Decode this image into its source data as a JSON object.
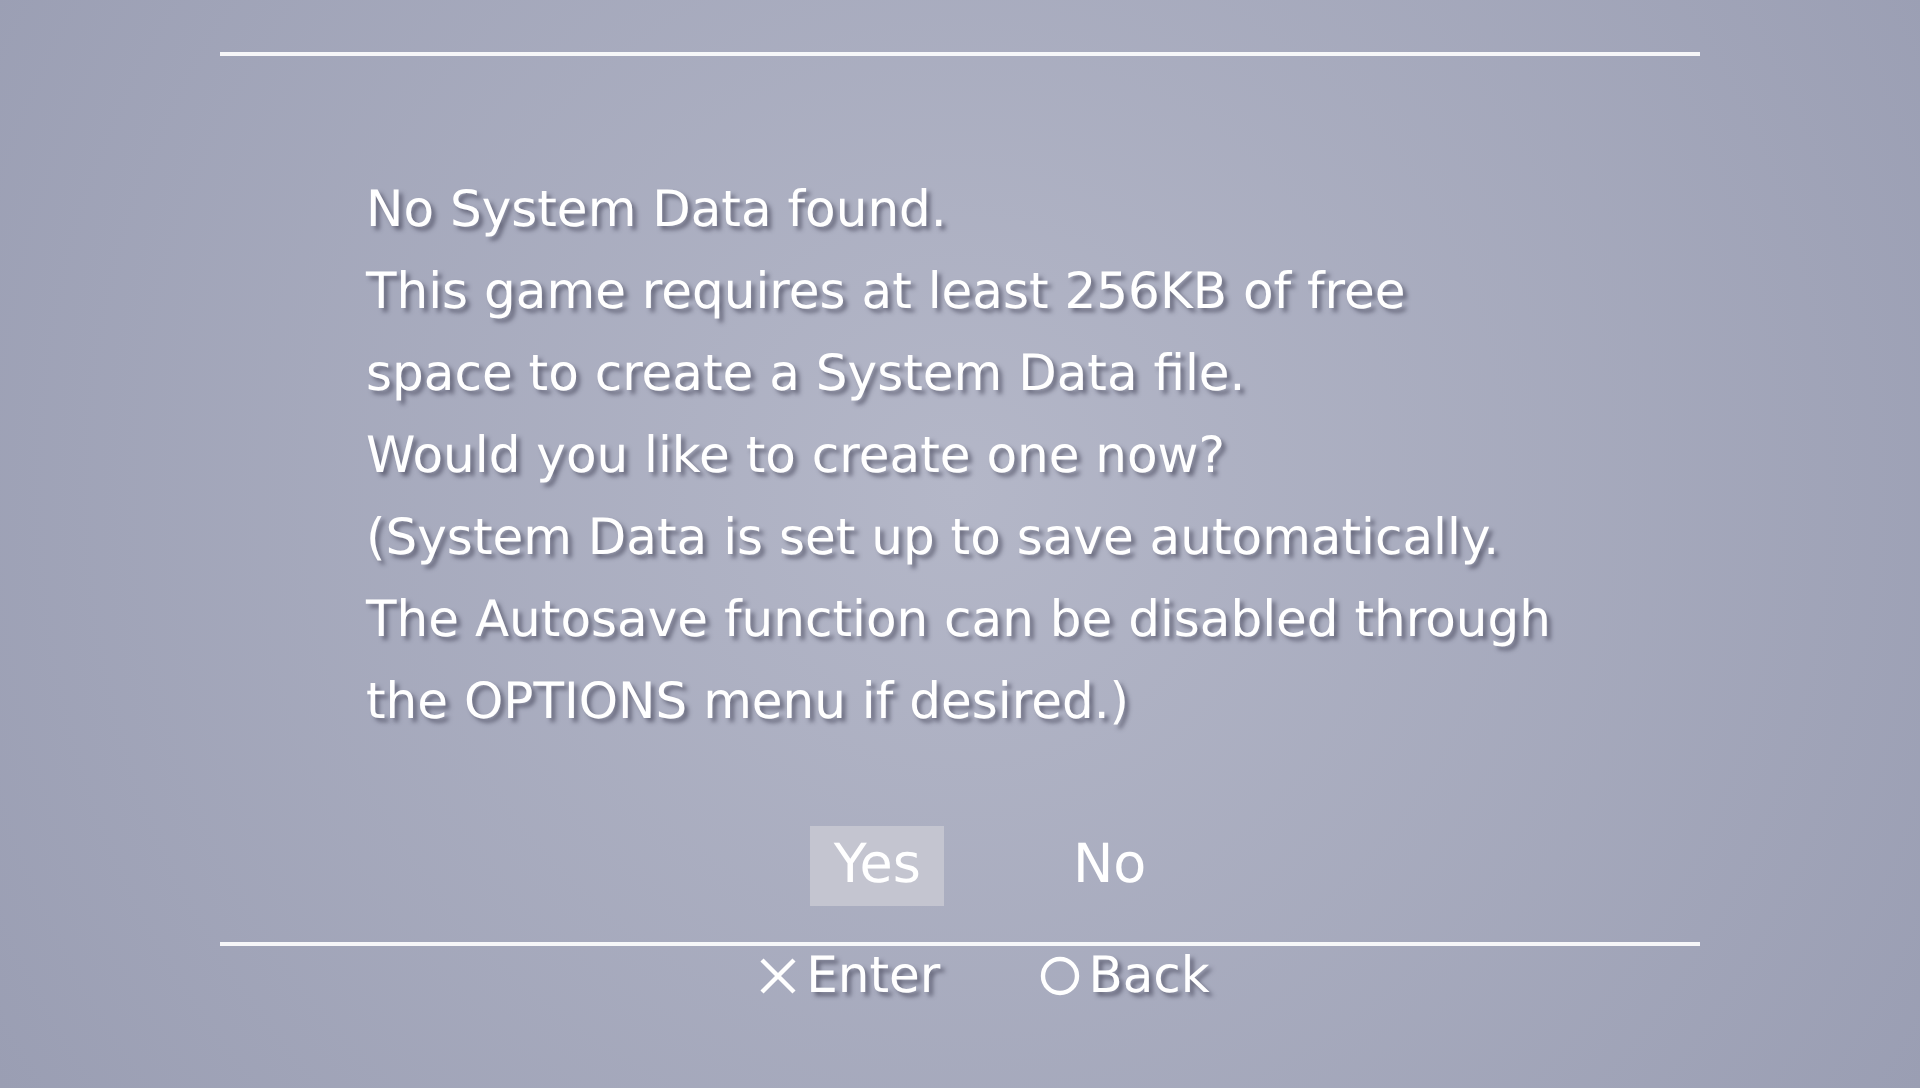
{
  "message": [
    "No System Data found.",
    "This game requires at least 256KB of free space to create a System Data file.",
    "Would you like to create one now?",
    "(System Data is set up to save automatically. The Autosave function can be disabled through the OPTIONS menu if desired.)"
  ],
  "options": [
    {
      "label": "Yes",
      "selected": true
    },
    {
      "label": "No",
      "selected": false
    }
  ],
  "footer": [
    {
      "kind": "cross",
      "label": "Enter"
    },
    {
      "kind": "circle",
      "label": "Back"
    }
  ]
}
